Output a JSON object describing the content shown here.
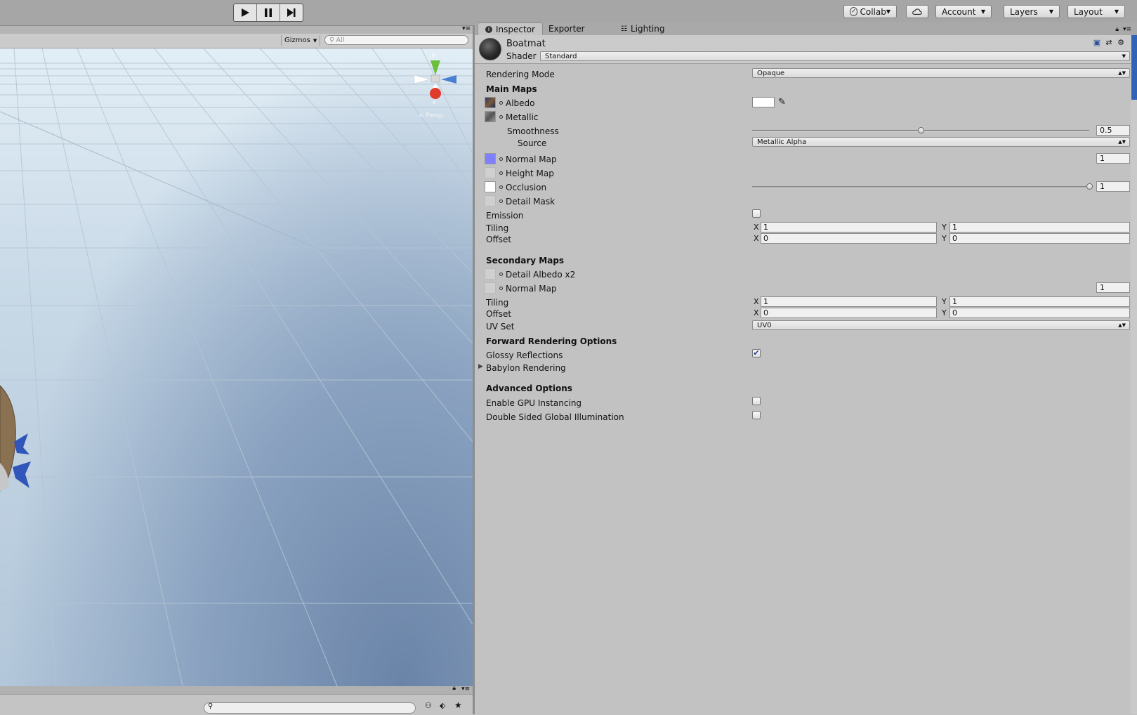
{
  "toolbar": {
    "collab": "Collab",
    "account": "Account",
    "layers": "Layers",
    "layout": "Layout"
  },
  "scene": {
    "gizmos": "Gizmos",
    "search_placeholder": "All",
    "axis_y": "y",
    "axis_x": "x",
    "persp": "< Persp"
  },
  "tabs": {
    "inspector": "Inspector",
    "exporter": "Exporter",
    "lighting": "Lighting"
  },
  "material": {
    "name": "Boatmat",
    "shader_label": "Shader",
    "shader_value": "Standard"
  },
  "props": {
    "rendering_mode_label": "Rendering Mode",
    "rendering_mode_value": "Opaque",
    "main_maps": "Main Maps",
    "albedo": "Albedo",
    "metallic": "Metallic",
    "smoothness": "Smoothness",
    "smoothness_value": "0.5",
    "smoothness_level": 0.5,
    "source": "Source",
    "source_value": "Metallic Alpha",
    "normal_map": "Normal Map",
    "normal_value": "1",
    "height_map": "Height Map",
    "occlusion": "Occlusion",
    "occlusion_value": "1",
    "occlusion_level": 1.0,
    "detail_mask": "Detail Mask",
    "emission": "Emission",
    "tiling": "Tiling",
    "offset": "Offset",
    "x": "X",
    "y": "Y",
    "tiling_x": "1",
    "tiling_y": "1",
    "offset_x": "0",
    "offset_y": "0",
    "secondary_maps": "Secondary Maps",
    "detail_albedo": "Detail Albedo x2",
    "sec_normal_map": "Normal Map",
    "sec_normal_value": "1",
    "sec_tiling_x": "1",
    "sec_tiling_y": "1",
    "sec_offset_x": "0",
    "sec_offset_y": "0",
    "uv_set": "UV Set",
    "uv_set_value": "UV0",
    "forward_rendering": "Forward Rendering Options",
    "glossy_reflections": "Glossy Reflections",
    "glossy_checked": true,
    "babylon_rendering": "Babylon Rendering",
    "advanced_options": "Advanced Options",
    "gpu_instancing": "Enable GPU Instancing",
    "double_sided_gi": "Double Sided Global Illumination"
  },
  "colors": {
    "normal_thumb": "#8080ff",
    "scrollbar": "#2f63b6"
  }
}
